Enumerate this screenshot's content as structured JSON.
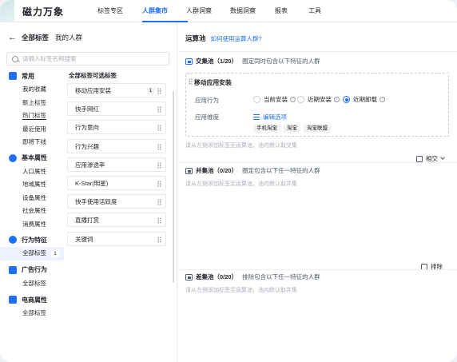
{
  "app": {
    "logo_text": "磁力万象"
  },
  "nav": {
    "items": [
      "标签专区",
      "人群集市",
      "人群洞察",
      "数据洞察",
      "报表",
      "工具"
    ],
    "active": 1
  },
  "left": {
    "header": {
      "title": "全部标签",
      "subtitle": "我的人群"
    },
    "search": {
      "placeholder": "请输入标签名称搜索"
    },
    "categories": [
      {
        "name": "常用",
        "icon": "home-icon",
        "items": [
          "我的收藏",
          "新上标签",
          "热门标签",
          "最近使用",
          "即将下线"
        ]
      },
      {
        "name": "基本属性",
        "icon": "pie-icon",
        "items": [
          "人口属性",
          "地域属性",
          "设备属性",
          "社会属性",
          "消费属性"
        ]
      },
      {
        "name": "行为特征",
        "icon": "behavior-icon",
        "items": [
          "全部标签"
        ],
        "badge": "1"
      },
      {
        "name": "广告行为",
        "icon": "ad-icon",
        "items": [
          "全部标签"
        ]
      },
      {
        "name": "电商属性",
        "icon": "shop-icon",
        "items": [
          "全部标签"
        ]
      }
    ],
    "tags_title": "全部标签可选标签",
    "tags": [
      {
        "label": "移动应用安装",
        "badge": "1"
      },
      {
        "label": "快手网红"
      },
      {
        "label": "行为意向"
      },
      {
        "label": "行为兴趣"
      },
      {
        "label": "应用渗透率"
      },
      {
        "label": "K-Star(明星)"
      },
      {
        "label": "快手使用活跃度"
      },
      {
        "label": "直播打赏"
      },
      {
        "label": "关键词"
      }
    ]
  },
  "right": {
    "title": "运算池",
    "help_link": "如何使用运算人群?",
    "intersect": {
      "name": "交集池（1/20）",
      "desc": "圈定同时包含以下特征的人群",
      "card": {
        "title": "移动应用安装",
        "behavior_label": "应用行为",
        "options": [
          "当前安装",
          "近期安装",
          "近期卸载"
        ],
        "selected": 2,
        "dimension_label": "应用维度",
        "edit_label": "编辑选项",
        "chips": [
          "手机淘宝",
          "淘宝",
          "淘宝联盟"
        ]
      },
      "hint": "请从左侧添加标签至运算池，池内默认取交集"
    },
    "op1": "相交",
    "union": {
      "name": "并集池（0/20）",
      "desc": "圈定包含以下任一特征的人群",
      "hint": "请从左侧添加标签至运算池，池内默认取并集"
    },
    "op2": "排除",
    "exclude": {
      "name": "差集池（0/20）",
      "desc": "排除包含以下任一特征的人群",
      "hint": "请从左侧添加标签至运算池，池内默认取并集"
    }
  }
}
